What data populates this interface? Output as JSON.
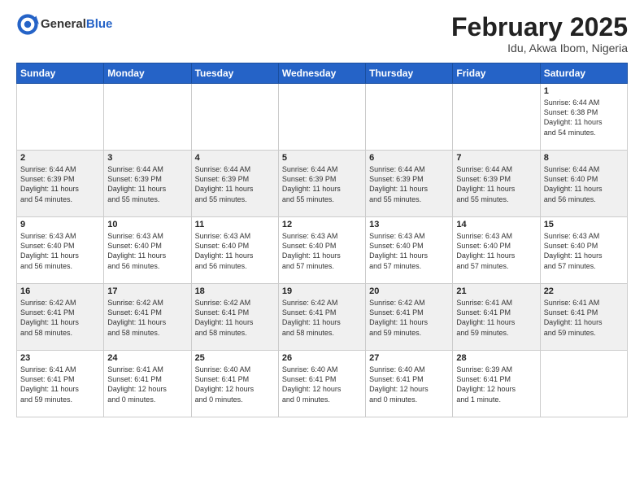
{
  "header": {
    "logo_general": "General",
    "logo_blue": "Blue",
    "month_title": "February 2025",
    "location": "Idu, Akwa Ibom, Nigeria"
  },
  "days_of_week": [
    "Sunday",
    "Monday",
    "Tuesday",
    "Wednesday",
    "Thursday",
    "Friday",
    "Saturday"
  ],
  "weeks": [
    [
      {
        "day": "",
        "info": ""
      },
      {
        "day": "",
        "info": ""
      },
      {
        "day": "",
        "info": ""
      },
      {
        "day": "",
        "info": ""
      },
      {
        "day": "",
        "info": ""
      },
      {
        "day": "",
        "info": ""
      },
      {
        "day": "1",
        "info": "Sunrise: 6:44 AM\nSunset: 6:38 PM\nDaylight: 11 hours\nand 54 minutes."
      }
    ],
    [
      {
        "day": "2",
        "info": "Sunrise: 6:44 AM\nSunset: 6:39 PM\nDaylight: 11 hours\nand 54 minutes."
      },
      {
        "day": "3",
        "info": "Sunrise: 6:44 AM\nSunset: 6:39 PM\nDaylight: 11 hours\nand 55 minutes."
      },
      {
        "day": "4",
        "info": "Sunrise: 6:44 AM\nSunset: 6:39 PM\nDaylight: 11 hours\nand 55 minutes."
      },
      {
        "day": "5",
        "info": "Sunrise: 6:44 AM\nSunset: 6:39 PM\nDaylight: 11 hours\nand 55 minutes."
      },
      {
        "day": "6",
        "info": "Sunrise: 6:44 AM\nSunset: 6:39 PM\nDaylight: 11 hours\nand 55 minutes."
      },
      {
        "day": "7",
        "info": "Sunrise: 6:44 AM\nSunset: 6:39 PM\nDaylight: 11 hours\nand 55 minutes."
      },
      {
        "day": "8",
        "info": "Sunrise: 6:44 AM\nSunset: 6:40 PM\nDaylight: 11 hours\nand 56 minutes."
      }
    ],
    [
      {
        "day": "9",
        "info": "Sunrise: 6:43 AM\nSunset: 6:40 PM\nDaylight: 11 hours\nand 56 minutes."
      },
      {
        "day": "10",
        "info": "Sunrise: 6:43 AM\nSunset: 6:40 PM\nDaylight: 11 hours\nand 56 minutes."
      },
      {
        "day": "11",
        "info": "Sunrise: 6:43 AM\nSunset: 6:40 PM\nDaylight: 11 hours\nand 56 minutes."
      },
      {
        "day": "12",
        "info": "Sunrise: 6:43 AM\nSunset: 6:40 PM\nDaylight: 11 hours\nand 57 minutes."
      },
      {
        "day": "13",
        "info": "Sunrise: 6:43 AM\nSunset: 6:40 PM\nDaylight: 11 hours\nand 57 minutes."
      },
      {
        "day": "14",
        "info": "Sunrise: 6:43 AM\nSunset: 6:40 PM\nDaylight: 11 hours\nand 57 minutes."
      },
      {
        "day": "15",
        "info": "Sunrise: 6:43 AM\nSunset: 6:40 PM\nDaylight: 11 hours\nand 57 minutes."
      }
    ],
    [
      {
        "day": "16",
        "info": "Sunrise: 6:42 AM\nSunset: 6:41 PM\nDaylight: 11 hours\nand 58 minutes."
      },
      {
        "day": "17",
        "info": "Sunrise: 6:42 AM\nSunset: 6:41 PM\nDaylight: 11 hours\nand 58 minutes."
      },
      {
        "day": "18",
        "info": "Sunrise: 6:42 AM\nSunset: 6:41 PM\nDaylight: 11 hours\nand 58 minutes."
      },
      {
        "day": "19",
        "info": "Sunrise: 6:42 AM\nSunset: 6:41 PM\nDaylight: 11 hours\nand 58 minutes."
      },
      {
        "day": "20",
        "info": "Sunrise: 6:42 AM\nSunset: 6:41 PM\nDaylight: 11 hours\nand 59 minutes."
      },
      {
        "day": "21",
        "info": "Sunrise: 6:41 AM\nSunset: 6:41 PM\nDaylight: 11 hours\nand 59 minutes."
      },
      {
        "day": "22",
        "info": "Sunrise: 6:41 AM\nSunset: 6:41 PM\nDaylight: 11 hours\nand 59 minutes."
      }
    ],
    [
      {
        "day": "23",
        "info": "Sunrise: 6:41 AM\nSunset: 6:41 PM\nDaylight: 11 hours\nand 59 minutes."
      },
      {
        "day": "24",
        "info": "Sunrise: 6:41 AM\nSunset: 6:41 PM\nDaylight: 12 hours\nand 0 minutes."
      },
      {
        "day": "25",
        "info": "Sunrise: 6:40 AM\nSunset: 6:41 PM\nDaylight: 12 hours\nand 0 minutes."
      },
      {
        "day": "26",
        "info": "Sunrise: 6:40 AM\nSunset: 6:41 PM\nDaylight: 12 hours\nand 0 minutes."
      },
      {
        "day": "27",
        "info": "Sunrise: 6:40 AM\nSunset: 6:41 PM\nDaylight: 12 hours\nand 0 minutes."
      },
      {
        "day": "28",
        "info": "Sunrise: 6:39 AM\nSunset: 6:41 PM\nDaylight: 12 hours\nand 1 minute."
      },
      {
        "day": "",
        "info": ""
      }
    ]
  ]
}
